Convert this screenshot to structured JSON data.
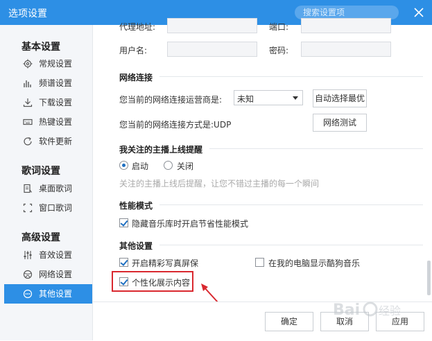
{
  "window": {
    "title": "选项设置",
    "search_placeholder": "搜索设置项"
  },
  "sidebar": {
    "groups": [
      "基本设置",
      "歌词设置",
      "高级设置"
    ],
    "items": [
      {
        "label": "常规设置",
        "icon": "gear-icon"
      },
      {
        "label": "频谱设置",
        "icon": "spectrum-icon"
      },
      {
        "label": "下载设置",
        "icon": "download-icon"
      },
      {
        "label": "热键设置",
        "icon": "keyboard-icon"
      },
      {
        "label": "软件更新",
        "icon": "update-icon"
      },
      {
        "label": "桌面歌词",
        "icon": "desktop-lyrics-icon"
      },
      {
        "label": "窗口歌词",
        "icon": "window-lyrics-icon"
      },
      {
        "label": "音效设置",
        "icon": "equalizer-icon"
      },
      {
        "label": "网络设置",
        "icon": "globe-icon"
      },
      {
        "label": "其他设置",
        "icon": "more-icon",
        "active": true
      }
    ]
  },
  "proxy": {
    "addr_label": "代理地址:",
    "port_label": "端口:",
    "user_label": "用户名:",
    "pwd_label": "密码:"
  },
  "network": {
    "title": "网络连接",
    "carrier_label": "您当前的网络连接运营商是:",
    "carrier_value": "未知",
    "auto_button": "自动选择最优",
    "method_label": "您当前的网络连接方式是:UDP",
    "test_button": "网络测试"
  },
  "anchor": {
    "title": "我关注的主播上线提醒",
    "on_label": "启动",
    "off_label": "关闭",
    "selected": "启动",
    "hint": "关注的主播上线后提醒，让您不错过主播的每一个瞬间"
  },
  "performance": {
    "title": "性能模式",
    "option_label": "隐藏音乐库时开启节省性能模式",
    "checked": true
  },
  "other": {
    "title": "其他设置",
    "options": [
      {
        "label": "开启精彩写真屏保",
        "checked": true
      },
      {
        "label": "在我的电脑显示酷狗音乐",
        "checked": false
      },
      {
        "label": "个性化展示内容",
        "checked": true
      }
    ]
  },
  "footer": {
    "ok": "确定",
    "cancel": "取消",
    "apply": "应用"
  },
  "colors": {
    "accent": "#2d8fe5",
    "highlight": "#d9282f"
  }
}
